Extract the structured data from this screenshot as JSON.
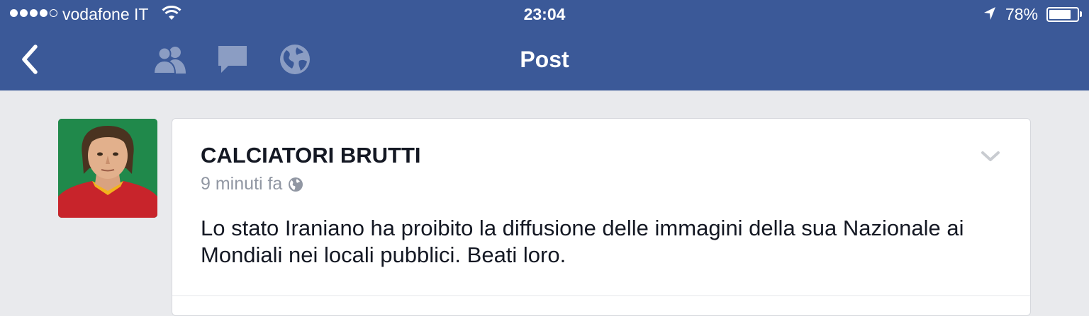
{
  "status_bar": {
    "signal_icon": "signal-dots",
    "carrier": "vodafone IT",
    "wifi_icon": "wifi-icon",
    "time": "23:04",
    "location_icon": "location-arrow-icon",
    "battery_percent": "78%",
    "battery_level": 0.78
  },
  "nav": {
    "back_icon": "chevron-left-icon",
    "icons": [
      "friends-icon",
      "messages-icon",
      "globe-icon"
    ],
    "title": "Post"
  },
  "post": {
    "author": "CALCIATORI BRUTTI",
    "timestamp": "9 minuti fa",
    "privacy_icon": "globe-icon",
    "text": "Lo stato Iraniano ha proibito la diffusione delle immagini della sua Nazionale ai Mondiali nei locali pubblici. Beati loro.",
    "menu_icon": "chevron-down-icon"
  },
  "colors": {
    "brand": "#3b5998",
    "background": "#e9eaed",
    "nav_icon_muted": "#8b9dc3",
    "meta_text": "#9197a3"
  }
}
